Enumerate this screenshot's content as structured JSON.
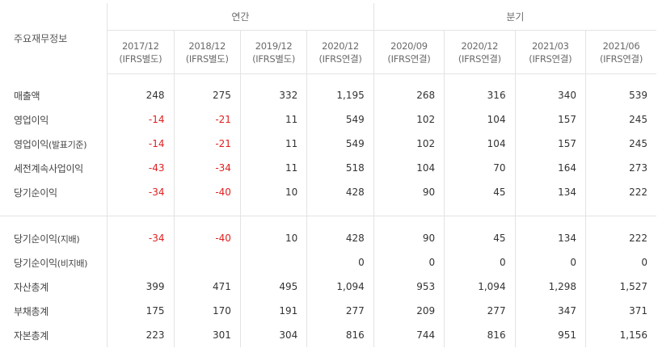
{
  "table": {
    "title": "주요재무정보",
    "groups": {
      "annual": "연간",
      "quarterly": "분기"
    },
    "periods": [
      {
        "date": "2017/12",
        "basis": "(IFRS별도)"
      },
      {
        "date": "2018/12",
        "basis": "(IFRS별도)"
      },
      {
        "date": "2019/12",
        "basis": "(IFRS별도)"
      },
      {
        "date": "2020/12",
        "basis": "(IFRS연결)"
      },
      {
        "date": "2020/09",
        "basis": "(IFRS연결)"
      },
      {
        "date": "2020/12",
        "basis": "(IFRS연결)"
      },
      {
        "date": "2021/03",
        "basis": "(IFRS연결)"
      },
      {
        "date": "2021/06",
        "basis": "(IFRS연결)"
      }
    ],
    "section1": [
      {
        "label": "매출액",
        "suffix": "",
        "values": [
          "248",
          "275",
          "332",
          "1,195",
          "268",
          "316",
          "340",
          "539"
        ]
      },
      {
        "label": "영업이익",
        "suffix": "",
        "values": [
          "-14",
          "-21",
          "11",
          "549",
          "102",
          "104",
          "157",
          "245"
        ]
      },
      {
        "label": "영업이익",
        "suffix": "(발표기준)",
        "values": [
          "-14",
          "-21",
          "11",
          "549",
          "102",
          "104",
          "157",
          "245"
        ]
      },
      {
        "label": "세전계속사업이익",
        "suffix": "",
        "values": [
          "-43",
          "-34",
          "11",
          "518",
          "104",
          "70",
          "164",
          "273"
        ]
      },
      {
        "label": "당기순이익",
        "suffix": "",
        "values": [
          "-34",
          "-40",
          "10",
          "428",
          "90",
          "45",
          "134",
          "222"
        ]
      }
    ],
    "section2": [
      {
        "label": "당기순이익",
        "suffix": "(지배)",
        "values": [
          "-34",
          "-40",
          "10",
          "428",
          "90",
          "45",
          "134",
          "222"
        ]
      },
      {
        "label": "당기순이익",
        "suffix": "(비지배)",
        "values": [
          "",
          "",
          "",
          "0",
          "0",
          "0",
          "0",
          "0"
        ]
      },
      {
        "label": "자산총계",
        "suffix": "",
        "values": [
          "399",
          "471",
          "495",
          "1,094",
          "953",
          "1,094",
          "1,298",
          "1,527"
        ]
      },
      {
        "label": "부채총계",
        "suffix": "",
        "values": [
          "175",
          "170",
          "191",
          "277",
          "209",
          "277",
          "347",
          "371"
        ]
      },
      {
        "label": "자본총계",
        "suffix": "",
        "values": [
          "223",
          "301",
          "304",
          "816",
          "744",
          "816",
          "951",
          "1,156"
        ]
      }
    ],
    "colors": {
      "negative": "#e02020",
      "text": "#333333",
      "border": "#e3e3e3"
    }
  }
}
